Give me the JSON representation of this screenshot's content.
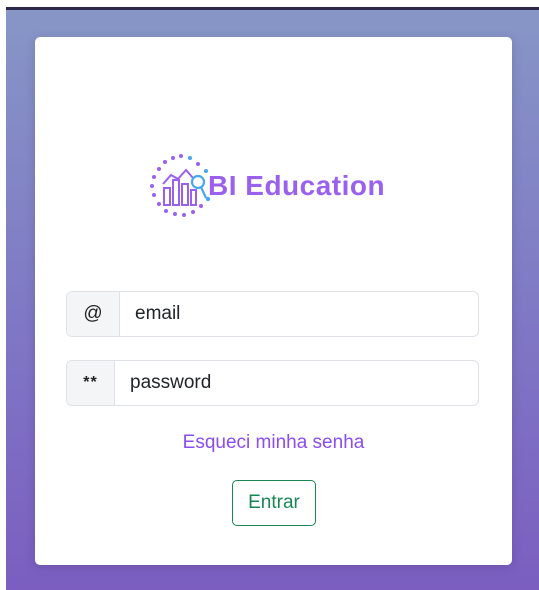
{
  "brand": {
    "name": "BI Education",
    "logo_icon": "bar-chart-magnifier-icon",
    "color": "#9a61ee"
  },
  "form": {
    "email": {
      "prefix": "@",
      "placeholder": "email",
      "value": ""
    },
    "password": {
      "prefix": "**",
      "placeholder": "password",
      "value": ""
    },
    "forgot_link": "Esqueci minha senha",
    "submit_label": "Entrar"
  },
  "colors": {
    "background_top": "#8796c6",
    "background_bottom": "#7b5ec0",
    "link": "#8b4dec",
    "submit": "#198754"
  }
}
